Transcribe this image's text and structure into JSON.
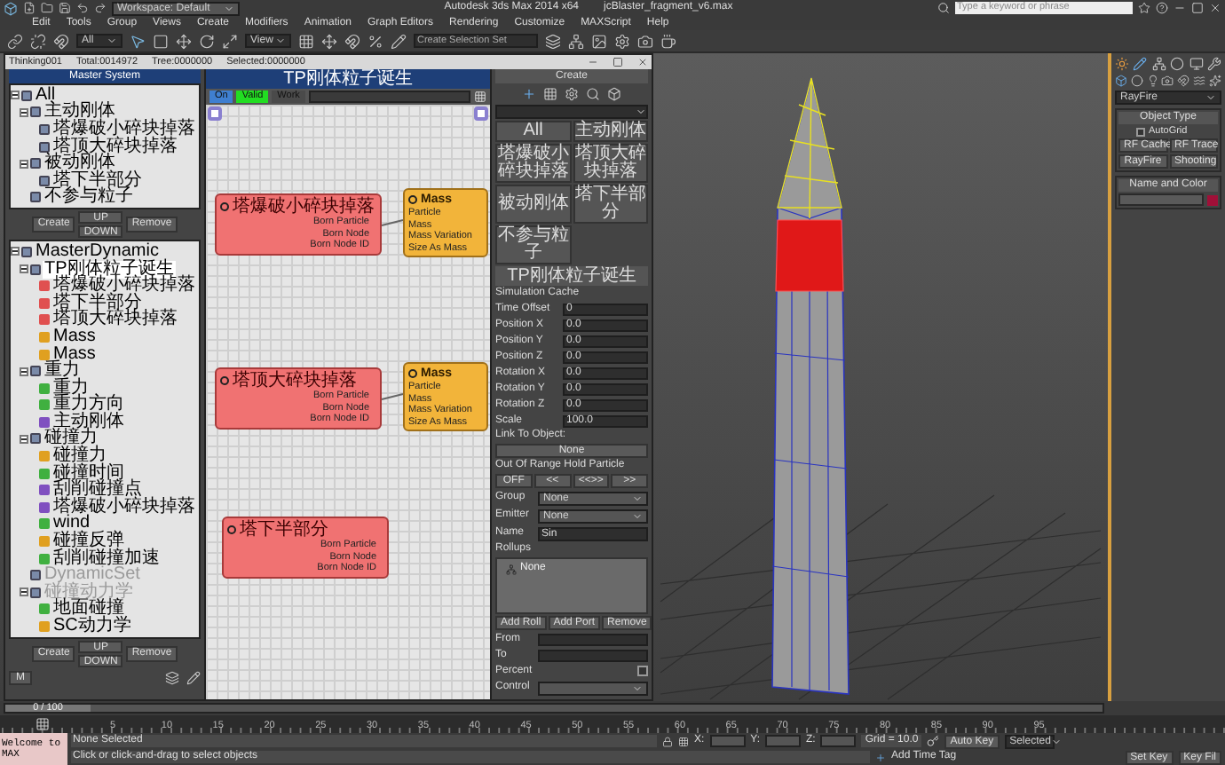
{
  "title_bar": {
    "workspace": "Workspace: Default",
    "app_title": "Autodesk 3ds Max 2014 x64",
    "file_name": "jcBlaster_fragment_v6.max",
    "search": {
      "placeholder": "Type a keyword or phrase"
    }
  },
  "menu": [
    "Edit",
    "Tools",
    "Group",
    "Views",
    "Create",
    "Modifiers",
    "Animation",
    "Graph Editors",
    "Rendering",
    "Customize",
    "MAXScript",
    "Help"
  ],
  "toolbar": {
    "selection_filter": "All",
    "reference_coord": "View",
    "selection_set": {
      "placeholder": "Create Selection Set"
    }
  },
  "thinking_window": {
    "title_parts": [
      "Thinking001",
      "Total:0014972",
      "Tree:0000000",
      "Selected:0000000"
    ],
    "master_system": {
      "title": "Master System",
      "tree": [
        {
          "label": "All",
          "children": [
            {
              "label": "主动刚体",
              "children": [
                {
                  "label": "塔爆破小碎块掉落"
                },
                {
                  "label": "塔顶大碎块掉落"
                }
              ]
            },
            {
              "label": "被动刚体",
              "children": [
                {
                  "label": "塔下半部分"
                }
              ]
            },
            {
              "label": "不参与粒子"
            }
          ]
        }
      ],
      "buttons": {
        "create": "Create",
        "up": "UP",
        "down": "DOWN",
        "remove": "Remove"
      }
    },
    "master_dynamic": {
      "tree": [
        {
          "label": "MasterDynamic",
          "selected": false,
          "disabled": false,
          "children": [
            {
              "label": "TP刚体粒子诞生",
              "selected": true,
              "disabled": false,
              "children": [
                {
                  "label": "塔爆破小碎块掉落",
                  "selected": false,
                  "disabled": false,
                  "color": "#e05050"
                },
                {
                  "label": "塔下半部分",
                  "selected": false,
                  "disabled": false,
                  "color": "#e05050"
                },
                {
                  "label": "塔顶大碎块掉落",
                  "selected": false,
                  "disabled": false,
                  "color": "#e05050"
                },
                {
                  "label": "Mass",
                  "selected": false,
                  "disabled": false,
                  "color": "#e0a020"
                },
                {
                  "label": "Mass",
                  "selected": false,
                  "disabled": false,
                  "color": "#e0a020"
                }
              ]
            },
            {
              "label": "重力",
              "selected": false,
              "disabled": false,
              "children": [
                {
                  "label": "重力",
                  "selected": false,
                  "disabled": false,
                  "color": "#40b040"
                },
                {
                  "label": "重力方向",
                  "selected": false,
                  "disabled": false,
                  "color": "#40b040"
                },
                {
                  "label": "主动刚体",
                  "selected": false,
                  "disabled": false,
                  "color": "#8050c0"
                }
              ]
            },
            {
              "label": "碰撞力",
              "selected": false,
              "disabled": false,
              "children": [
                {
                  "label": "碰撞力",
                  "selected": false,
                  "disabled": false,
                  "color": "#e0a020"
                },
                {
                  "label": "碰撞时间",
                  "selected": false,
                  "disabled": false,
                  "color": "#40b040"
                },
                {
                  "label": "刮削碰撞点",
                  "selected": false,
                  "disabled": false,
                  "color": "#8050c0"
                },
                {
                  "label": "塔爆破小碎块掉落",
                  "selected": false,
                  "disabled": false,
                  "color": "#8050c0"
                },
                {
                  "label": "wind",
                  "selected": false,
                  "disabled": false,
                  "color": "#40b040"
                },
                {
                  "label": "碰撞反弹",
                  "selected": false,
                  "disabled": false,
                  "color": "#e0a020"
                },
                {
                  "label": "刮削碰撞加速",
                  "selected": false,
                  "disabled": false,
                  "color": "#40b040"
                }
              ]
            },
            {
              "label": "DynamicSet",
              "selected": false,
              "disabled": true
            },
            {
              "label": "碰撞动力学",
              "selected": false,
              "disabled": true,
              "children": [
                {
                  "label": "地面碰撞",
                  "selected": false,
                  "disabled": false,
                  "color": "#40b040"
                },
                {
                  "label": "SC动力学",
                  "selected": false,
                  "disabled": false,
                  "color": "#e0a020"
                }
              ]
            }
          ]
        }
      ],
      "buttons": {
        "create": "Create",
        "up": "UP",
        "down": "DOWN",
        "remove": "Remove"
      },
      "m_button": "M"
    },
    "graph": {
      "title": "TP刚体粒子诞生",
      "status": [
        {
          "label": "On",
          "color": "#3f7fd0"
        },
        {
          "label": "Valid",
          "color": "#22dd22"
        },
        {
          "label": "Work",
          "color": "#4a4a4a"
        }
      ],
      "nodes": [
        {
          "kind": "emitter",
          "title": "塔爆破小碎块掉落",
          "ports": [
            "Born Particle",
            "Born Node",
            "Born Node ID"
          ]
        },
        {
          "kind": "operator",
          "title": "Mass",
          "ports": [
            "Particle",
            "Mass",
            "Mass Variation",
            "Size As Mass"
          ]
        },
        {
          "kind": "emitter",
          "title": "塔顶大碎块掉落",
          "ports": [
            "Born Particle",
            "Born Node",
            "Born Node ID"
          ]
        },
        {
          "kind": "operator",
          "title": "Mass",
          "ports": [
            "Particle",
            "Mass",
            "Mass Variation",
            "Size As Mass"
          ]
        },
        {
          "kind": "emitter",
          "title": "塔下半部分",
          "ports": [
            "Born Particle",
            "Born Node",
            "Born Node ID"
          ]
        }
      ]
    },
    "panel": {
      "create_title": "Create",
      "group_buttons": [
        "All",
        "主动刚体",
        "塔爆破小碎块掉落",
        "塔顶大碎块掉落",
        "被动刚体",
        "塔下半部分",
        "不参与粒子"
      ],
      "rollout_title": "TP刚体粒子诞生",
      "cache_title": "Simulation Cache",
      "fields": [
        {
          "label": "Time Offset",
          "value": "0"
        },
        {
          "label": "Position X",
          "value": "0.0"
        },
        {
          "label": "Position Y",
          "value": "0.0"
        },
        {
          "label": "Position Z",
          "value": "0.0"
        },
        {
          "label": "Rotation X",
          "value": "0.0"
        },
        {
          "label": "Rotation Y",
          "value": "0.0"
        },
        {
          "label": "Rotation Z",
          "value": "0.0"
        },
        {
          "label": "Scale",
          "value": "100.0"
        }
      ],
      "link_label": "Link To Object:",
      "link_button": "None",
      "range_label": "Out Of Range Hold Particle",
      "range_buttons": [
        "OFF",
        "<<",
        "<<>>",
        ">>"
      ],
      "group": {
        "label": "Group",
        "value": "None"
      },
      "emitter": {
        "label": "Emitter",
        "value": "None"
      },
      "name": {
        "label": "Name",
        "value": "Sin"
      },
      "rollups_label": "Rollups",
      "rollups": [
        "None"
      ],
      "roll_buttons": [
        "Add Roll",
        "Add Port",
        "Remove"
      ],
      "from_label": "From",
      "to_label": "To",
      "percent": {
        "label": "Percent",
        "checked": false
      },
      "control_label": "Control"
    }
  },
  "command_panel": {
    "dropdown": "RayFire",
    "object_type": {
      "title": "Object Type",
      "autogrid": {
        "label": "AutoGrid",
        "checked": false
      },
      "buttons": [
        "RF Cache",
        "RF Trace",
        "RayFire",
        "Shooting"
      ]
    },
    "name_and_color": {
      "title": "Name and Color",
      "color": "#a01038"
    }
  },
  "timeline": {
    "slider_label": "0 / 100",
    "level": 0,
    "ticks": [
      "5",
      "10",
      "15",
      "20",
      "25",
      "30",
      "35",
      "40",
      "45",
      "50",
      "55",
      "60",
      "65",
      "70",
      "75",
      "80",
      "85",
      "90",
      "95"
    ]
  },
  "status": {
    "listener": "Welcome to MAX",
    "selection": "None Selected",
    "prompt": "Click or click-and-drag to select objects",
    "x_label": "X:",
    "y_label": "Y:",
    "z_label": "Z:",
    "grid": "Grid = 10.0",
    "add_time_tag": "Add Time Tag",
    "auto_key": "Auto Key",
    "key_mode": "Selected",
    "set_key": "Set Key",
    "key_filters": "Key Fil"
  }
}
